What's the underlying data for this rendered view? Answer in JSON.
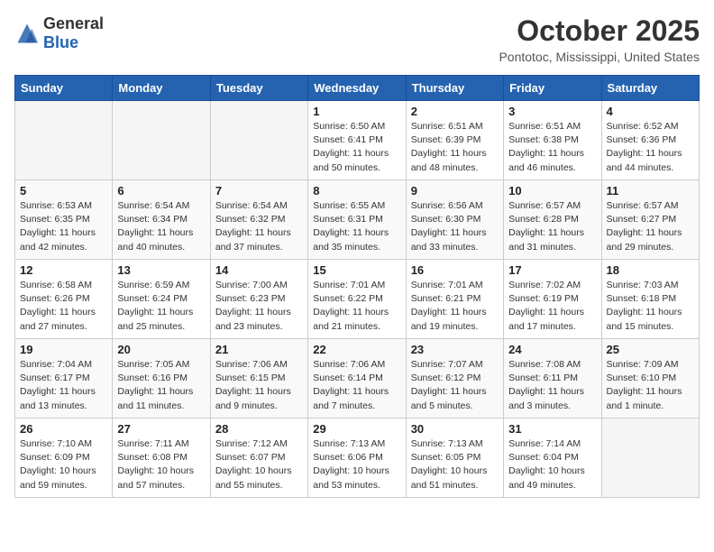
{
  "logo": {
    "general": "General",
    "blue": "Blue"
  },
  "title": "October 2025",
  "location": "Pontotoc, Mississippi, United States",
  "weekdays": [
    "Sunday",
    "Monday",
    "Tuesday",
    "Wednesday",
    "Thursday",
    "Friday",
    "Saturday"
  ],
  "weeks": [
    [
      {
        "day": "",
        "info": ""
      },
      {
        "day": "",
        "info": ""
      },
      {
        "day": "",
        "info": ""
      },
      {
        "day": "1",
        "info": "Sunrise: 6:50 AM\nSunset: 6:41 PM\nDaylight: 11 hours\nand 50 minutes."
      },
      {
        "day": "2",
        "info": "Sunrise: 6:51 AM\nSunset: 6:39 PM\nDaylight: 11 hours\nand 48 minutes."
      },
      {
        "day": "3",
        "info": "Sunrise: 6:51 AM\nSunset: 6:38 PM\nDaylight: 11 hours\nand 46 minutes."
      },
      {
        "day": "4",
        "info": "Sunrise: 6:52 AM\nSunset: 6:36 PM\nDaylight: 11 hours\nand 44 minutes."
      }
    ],
    [
      {
        "day": "5",
        "info": "Sunrise: 6:53 AM\nSunset: 6:35 PM\nDaylight: 11 hours\nand 42 minutes."
      },
      {
        "day": "6",
        "info": "Sunrise: 6:54 AM\nSunset: 6:34 PM\nDaylight: 11 hours\nand 40 minutes."
      },
      {
        "day": "7",
        "info": "Sunrise: 6:54 AM\nSunset: 6:32 PM\nDaylight: 11 hours\nand 37 minutes."
      },
      {
        "day": "8",
        "info": "Sunrise: 6:55 AM\nSunset: 6:31 PM\nDaylight: 11 hours\nand 35 minutes."
      },
      {
        "day": "9",
        "info": "Sunrise: 6:56 AM\nSunset: 6:30 PM\nDaylight: 11 hours\nand 33 minutes."
      },
      {
        "day": "10",
        "info": "Sunrise: 6:57 AM\nSunset: 6:28 PM\nDaylight: 11 hours\nand 31 minutes."
      },
      {
        "day": "11",
        "info": "Sunrise: 6:57 AM\nSunset: 6:27 PM\nDaylight: 11 hours\nand 29 minutes."
      }
    ],
    [
      {
        "day": "12",
        "info": "Sunrise: 6:58 AM\nSunset: 6:26 PM\nDaylight: 11 hours\nand 27 minutes."
      },
      {
        "day": "13",
        "info": "Sunrise: 6:59 AM\nSunset: 6:24 PM\nDaylight: 11 hours\nand 25 minutes."
      },
      {
        "day": "14",
        "info": "Sunrise: 7:00 AM\nSunset: 6:23 PM\nDaylight: 11 hours\nand 23 minutes."
      },
      {
        "day": "15",
        "info": "Sunrise: 7:01 AM\nSunset: 6:22 PM\nDaylight: 11 hours\nand 21 minutes."
      },
      {
        "day": "16",
        "info": "Sunrise: 7:01 AM\nSunset: 6:21 PM\nDaylight: 11 hours\nand 19 minutes."
      },
      {
        "day": "17",
        "info": "Sunrise: 7:02 AM\nSunset: 6:19 PM\nDaylight: 11 hours\nand 17 minutes."
      },
      {
        "day": "18",
        "info": "Sunrise: 7:03 AM\nSunset: 6:18 PM\nDaylight: 11 hours\nand 15 minutes."
      }
    ],
    [
      {
        "day": "19",
        "info": "Sunrise: 7:04 AM\nSunset: 6:17 PM\nDaylight: 11 hours\nand 13 minutes."
      },
      {
        "day": "20",
        "info": "Sunrise: 7:05 AM\nSunset: 6:16 PM\nDaylight: 11 hours\nand 11 minutes."
      },
      {
        "day": "21",
        "info": "Sunrise: 7:06 AM\nSunset: 6:15 PM\nDaylight: 11 hours\nand 9 minutes."
      },
      {
        "day": "22",
        "info": "Sunrise: 7:06 AM\nSunset: 6:14 PM\nDaylight: 11 hours\nand 7 minutes."
      },
      {
        "day": "23",
        "info": "Sunrise: 7:07 AM\nSunset: 6:12 PM\nDaylight: 11 hours\nand 5 minutes."
      },
      {
        "day": "24",
        "info": "Sunrise: 7:08 AM\nSunset: 6:11 PM\nDaylight: 11 hours\nand 3 minutes."
      },
      {
        "day": "25",
        "info": "Sunrise: 7:09 AM\nSunset: 6:10 PM\nDaylight: 11 hours\nand 1 minute."
      }
    ],
    [
      {
        "day": "26",
        "info": "Sunrise: 7:10 AM\nSunset: 6:09 PM\nDaylight: 10 hours\nand 59 minutes."
      },
      {
        "day": "27",
        "info": "Sunrise: 7:11 AM\nSunset: 6:08 PM\nDaylight: 10 hours\nand 57 minutes."
      },
      {
        "day": "28",
        "info": "Sunrise: 7:12 AM\nSunset: 6:07 PM\nDaylight: 10 hours\nand 55 minutes."
      },
      {
        "day": "29",
        "info": "Sunrise: 7:13 AM\nSunset: 6:06 PM\nDaylight: 10 hours\nand 53 minutes."
      },
      {
        "day": "30",
        "info": "Sunrise: 7:13 AM\nSunset: 6:05 PM\nDaylight: 10 hours\nand 51 minutes."
      },
      {
        "day": "31",
        "info": "Sunrise: 7:14 AM\nSunset: 6:04 PM\nDaylight: 10 hours\nand 49 minutes."
      },
      {
        "day": "",
        "info": ""
      }
    ]
  ]
}
